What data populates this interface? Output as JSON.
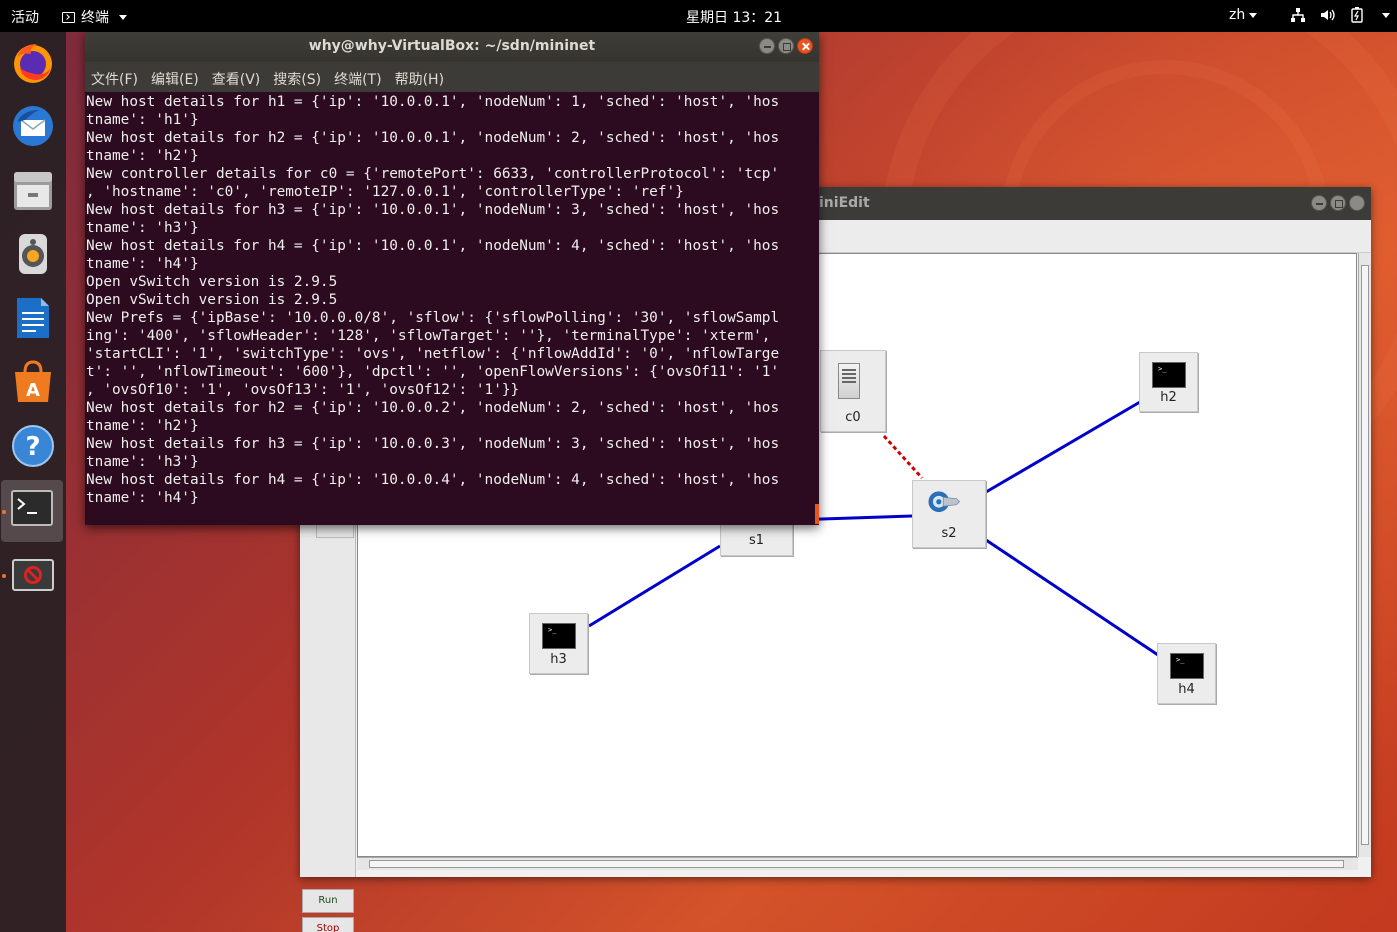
{
  "topbar": {
    "activities": "活动",
    "app_menu": "终端",
    "clock": "星期日 13：21",
    "language": "zh"
  },
  "dock": {
    "items": [
      {
        "name": "firefox-icon"
      },
      {
        "name": "thunderbird-icon"
      },
      {
        "name": "files-icon"
      },
      {
        "name": "rhythmbox-icon"
      },
      {
        "name": "writer-icon"
      },
      {
        "name": "software-icon"
      },
      {
        "name": "help-icon"
      },
      {
        "name": "terminal-icon"
      },
      {
        "name": "blocked-app-icon"
      }
    ]
  },
  "terminal": {
    "title": "why@why-VirtualBox: ~/sdn/mininet",
    "menu": [
      "文件(F)",
      "编辑(E)",
      "查看(V)",
      "搜索(S)",
      "终端(T)",
      "帮助(H)"
    ],
    "lines": [
      "New host details for h1 = {'ip': '10.0.0.1', 'nodeNum': 1, 'sched': 'host', 'hos",
      "tname': 'h1'}",
      "New host details for h2 = {'ip': '10.0.0.1', 'nodeNum': 2, 'sched': 'host', 'hos",
      "tname': 'h2'}",
      "New controller details for c0 = {'remotePort': 6633, 'controllerProtocol': 'tcp'",
      ", 'hostname': 'c0', 'remoteIP': '127.0.0.1', 'controllerType': 'ref'}",
      "New host details for h3 = {'ip': '10.0.0.1', 'nodeNum': 3, 'sched': 'host', 'hos",
      "tname': 'h3'}",
      "New host details for h4 = {'ip': '10.0.0.1', 'nodeNum': 4, 'sched': 'host', 'hos",
      "tname': 'h4'}",
      "Open vSwitch version is 2.9.5",
      "Open vSwitch version is 2.9.5",
      "New Prefs = {'ipBase': '10.0.0.0/8', 'sflow': {'sflowPolling': '30', 'sflowSampl",
      "ing': '400', 'sflowHeader': '128', 'sflowTarget': ''}, 'terminalType': 'xterm',",
      "'startCLI': '1', 'switchType': 'ovs', 'netflow': {'nflowAddId': '0', 'nflowTarge",
      "t': '', 'nflowTimeout': '600'}, 'dpctl': '', 'openFlowVersions': {'ovsOf11': '1'",
      ", 'ovsOf10': '1', 'ovsOf13': '1', 'ovsOf12': '1'}}",
      "New host details for h2 = {'ip': '10.0.0.2', 'nodeNum': 2, 'sched': 'host', 'hos",
      "tname': 'h2'}",
      "New host details for h3 = {'ip': '10.0.0.3', 'nodeNum': 3, 'sched': 'host', 'hos",
      "tname': 'h3'}",
      "New host details for h4 = {'ip': '10.0.0.4', 'nodeNum': 4, 'sched': 'host', 'hos",
      "tname': 'h4'}"
    ]
  },
  "miniedit": {
    "title_visible": "iniEdit",
    "run_label": "Run",
    "stop_label": "Stop",
    "nodes": {
      "c0": "c0",
      "s1": "s1",
      "s2": "s2",
      "h2": "h2",
      "h3": "h3",
      "h4": "h4"
    },
    "colors": {
      "link": "#0000cc",
      "controller_link": "#cc0000"
    }
  }
}
